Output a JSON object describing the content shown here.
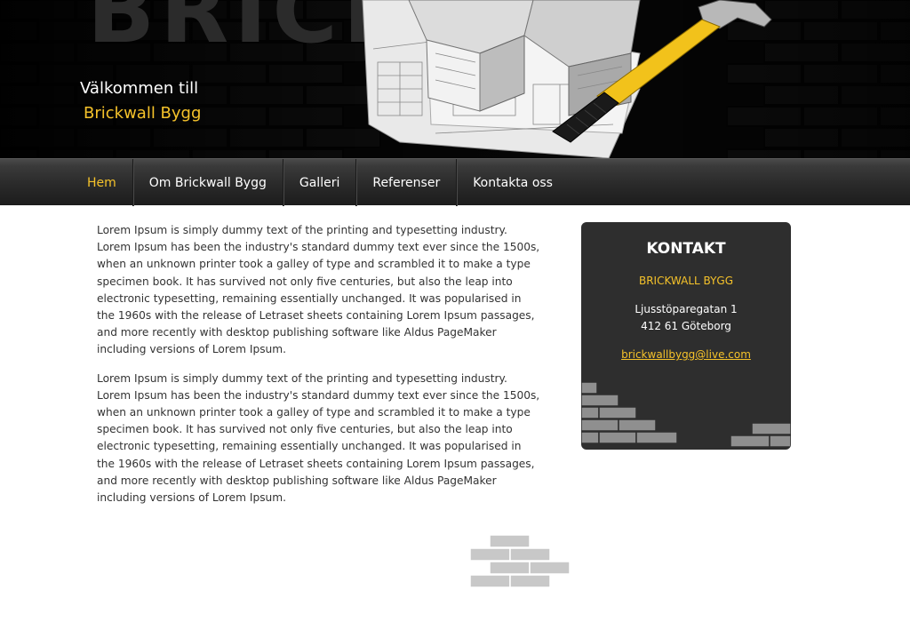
{
  "header": {
    "big_word": "BRICK",
    "welcome_line": "Välkommen till",
    "brand_line": "Brickwall Bygg"
  },
  "nav": {
    "items": [
      {
        "label": "Hem",
        "active": true
      },
      {
        "label": "Om Brickwall Bygg",
        "active": false
      },
      {
        "label": "Galleri",
        "active": false
      },
      {
        "label": "Referenser",
        "active": false
      },
      {
        "label": "Kontakta oss",
        "active": false
      }
    ]
  },
  "main": {
    "paragraphs": [
      "Lorem Ipsum is simply dummy text of the printing and typesetting industry. Lorem Ipsum has been the industry's standard dummy text ever since the 1500s, when an unknown printer took a galley of type and scrambled it to make a type specimen book. It has survived not only five centuries, but also the leap into electronic typesetting, remaining essentially unchanged. It was popularised in the 1960s with the release of Letraset sheets containing Lorem Ipsum passages, and more recently with desktop publishing software like Aldus PageMaker including versions of Lorem Ipsum.",
      "Lorem Ipsum is simply dummy text of the printing and typesetting industry. Lorem Ipsum has been the industry's standard dummy text ever since the 1500s, when an unknown printer took a galley of type and scrambled it to make a type specimen book. It has survived not only five centuries, but also the leap into electronic typesetting, remaining essentially unchanged. It was popularised in the 1960s with the release of Letraset sheets containing Lorem Ipsum passages, and more recently with desktop publishing software like Aldus PageMaker including versions of Lorem Ipsum."
    ]
  },
  "contact": {
    "title": "KONTAKT",
    "company": "BRICKWALL BYGG",
    "street": "Ljusstöparegatan 1",
    "city": "412 61 Göteborg",
    "email": "brickwallbygg@live.com"
  },
  "colors": {
    "accent": "#f5c22a",
    "header_bg": "#080808",
    "nav_bg": "#2a2a2a",
    "contact_bg": "#2e2e2e",
    "text": "#333333",
    "brick_gray": "#c8c8c8"
  },
  "icons": {
    "hammer": "hammer-icon",
    "blueprint": "blueprint-icon",
    "bricks": "bricks-icon"
  }
}
